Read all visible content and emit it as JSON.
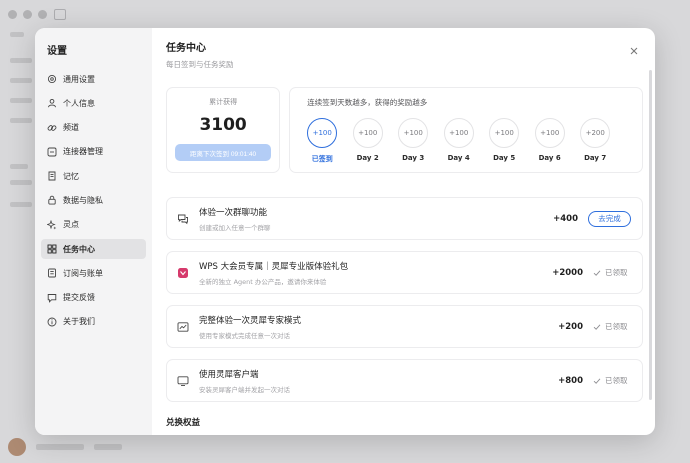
{
  "sidebar": {
    "title": "设置",
    "items": [
      {
        "label": "通用设置",
        "icon": "gear-icon"
      },
      {
        "label": "个人信息",
        "icon": "user-icon"
      },
      {
        "label": "频道",
        "icon": "link-icon"
      },
      {
        "label": "连接器管理",
        "icon": "connector-icon"
      },
      {
        "label": "记忆",
        "icon": "memory-icon"
      },
      {
        "label": "数据与隐私",
        "icon": "lock-icon"
      },
      {
        "label": "灵点",
        "icon": "sparkle-icon"
      },
      {
        "label": "任务中心",
        "icon": "tasks-icon",
        "active": true
      },
      {
        "label": "订阅与账单",
        "icon": "billing-icon"
      },
      {
        "label": "提交反馈",
        "icon": "feedback-icon"
      },
      {
        "label": "关于我们",
        "icon": "info-icon"
      }
    ]
  },
  "main": {
    "title": "任务中心",
    "subtitle": "每日签到与任务奖励"
  },
  "total": {
    "label": "累计获得",
    "value": "3100",
    "countdown": "距离下次签到 09:01:40"
  },
  "streak": {
    "description": "连续签到天数越多，获得的奖励越多",
    "days": [
      {
        "reward": "+100",
        "label": "已签到",
        "done": true
      },
      {
        "reward": "+100",
        "label": "Day 2"
      },
      {
        "reward": "+100",
        "label": "Day 3"
      },
      {
        "reward": "+100",
        "label": "Day 4"
      },
      {
        "reward": "+100",
        "label": "Day 5"
      },
      {
        "reward": "+100",
        "label": "Day 6"
      },
      {
        "reward": "+200",
        "label": "Day 7"
      }
    ]
  },
  "tasks": [
    {
      "title": "体验一次群聊功能",
      "desc": "创建或加入任意一个群聊",
      "reward": "+400",
      "action": "去完成",
      "icon": "chat-icon"
    },
    {
      "title": "WPS 大会员专属｜灵犀专业版体验礼包",
      "desc": "全新的独立 Agent 办公产品，邀请你来体验",
      "reward": "+2000",
      "status": "已领取",
      "icon": "wps-logo-icon"
    },
    {
      "title": "完整体验一次灵犀专家模式",
      "desc": "使用专家模式完成任意一次对话",
      "reward": "+200",
      "status": "已领取",
      "icon": "chart-icon"
    },
    {
      "title": "使用灵犀客户端",
      "desc": "安装灵犀客户端并发起一次对话",
      "reward": "+800",
      "status": "已领取",
      "icon": "monitor-icon"
    }
  ],
  "redeem": {
    "title": "兑换权益"
  },
  "colors": {
    "accent": "#2f6fdd",
    "countdown_bg": "#b3cdf6",
    "wps_logo": "#d63a6c"
  }
}
